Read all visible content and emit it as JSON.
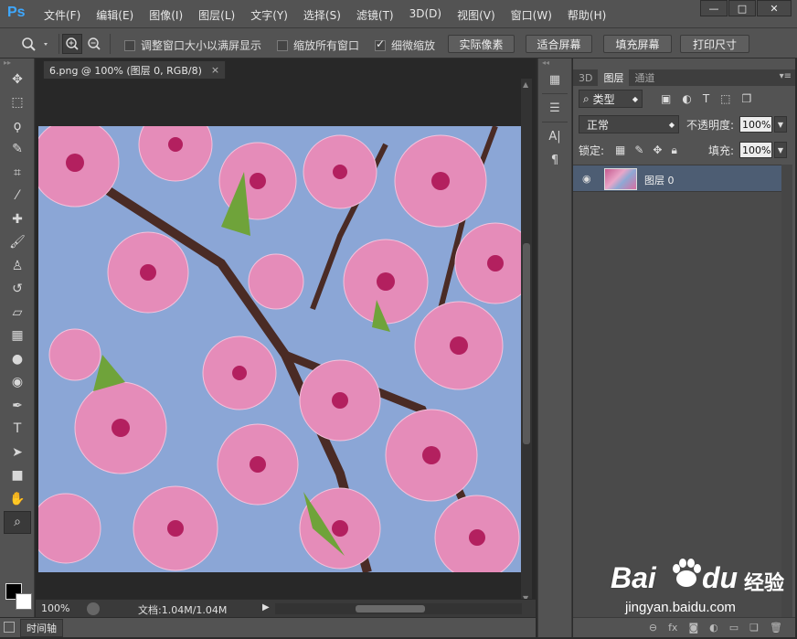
{
  "app": {
    "logo": "Ps"
  },
  "menu": [
    "文件(F)",
    "编辑(E)",
    "图像(I)",
    "图层(L)",
    "文字(Y)",
    "选择(S)",
    "滤镜(T)",
    "3D(D)",
    "视图(V)",
    "窗口(W)",
    "帮助(H)"
  ],
  "window_controls": {
    "minimize": "—",
    "restore": "□",
    "close": "✕"
  },
  "options": {
    "resize_windows": {
      "label": "调整窗口大小以满屏显示",
      "checked": false
    },
    "zoom_all": {
      "label": "缩放所有窗口",
      "checked": false
    },
    "scrubby_zoom": {
      "label": "细微缩放",
      "checked": true
    },
    "actual_pixels": "实际像素",
    "fit_screen": "适合屏幕",
    "fill_screen": "填充屏幕",
    "print_size": "打印尺寸"
  },
  "document": {
    "tab_title": "6.png @ 100% (图层 0, RGB/8)",
    "tab_close": "×"
  },
  "status": {
    "zoom": "100%",
    "doc_info": "文档:1.04M/1.04M"
  },
  "timeline": {
    "tab_label": "时间轴"
  },
  "panel": {
    "tabs": [
      "3D",
      "图层",
      "通道"
    ],
    "active_tab": "图层",
    "kind_filter": "类型",
    "blend_mode": "正常",
    "opacity_label": "不透明度:",
    "opacity_value": "100%",
    "lock_label": "锁定:",
    "fill_label": "填充:",
    "fill_value": "100%",
    "layers": [
      {
        "name": "图层 0",
        "visible": true
      }
    ]
  },
  "watermark": {
    "brand_left": "Bai",
    "brand_right": "du",
    "brand_cn": "经验",
    "url": "jingyan.baidu.com"
  },
  "colors": {
    "accent": "#3ea8ff",
    "panel_bg": "#535353",
    "canvas_bg": "#282828",
    "layer_selected": "#4d5d73"
  }
}
